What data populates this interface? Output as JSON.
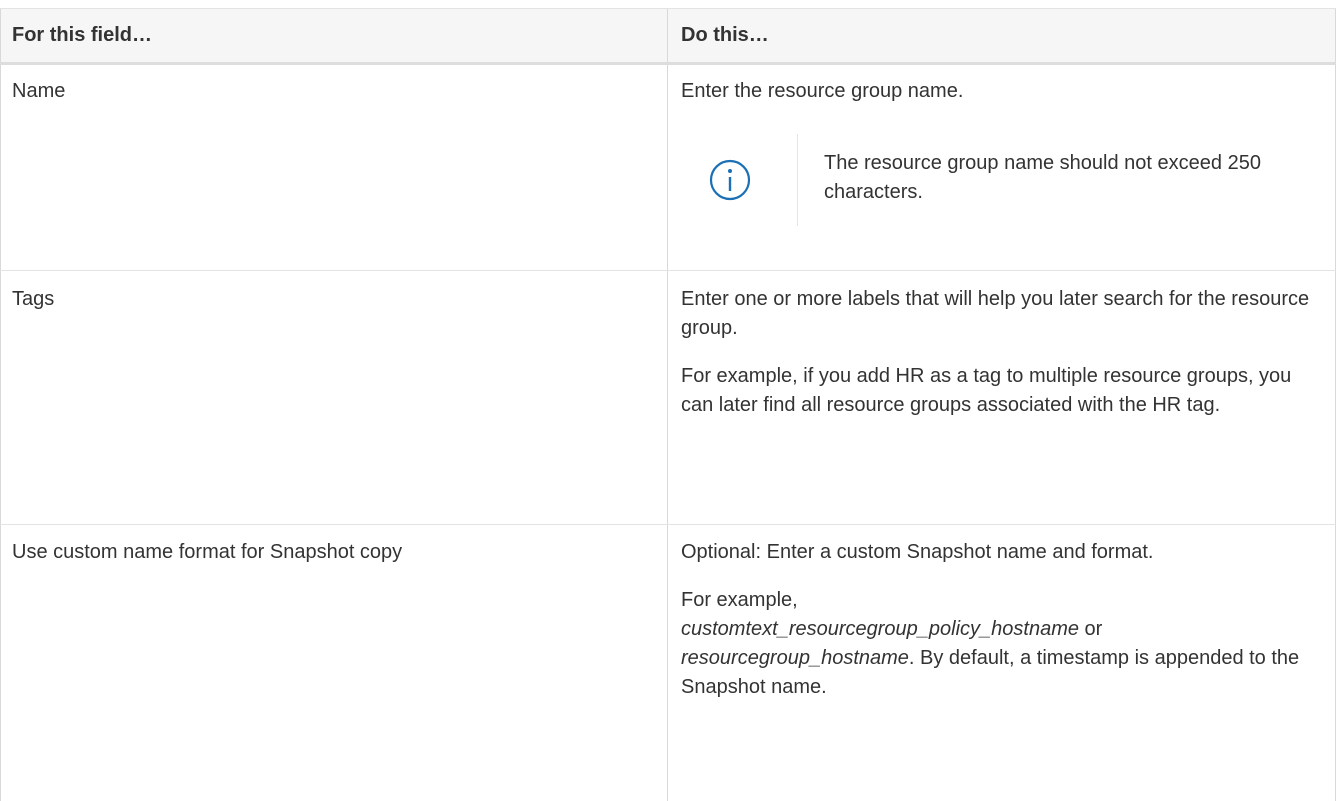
{
  "table": {
    "headers": [
      "For this field…",
      "Do this…"
    ],
    "rows": [
      {
        "field": "Name",
        "paragraphs": [
          "Enter the resource group name."
        ],
        "note": "The resource group name should not exceed 250 characters."
      },
      {
        "field": "Tags",
        "paragraphs": [
          "Enter one or more labels that will help you later search for the resource group.",
          "For example, if you add HR as a tag to multiple resource groups, you can later find all resource groups associated with the HR tag."
        ]
      },
      {
        "field": "Use custom name format for Snapshot copy",
        "paragraphs": [
          "Optional: Enter a custom Snapshot name and format."
        ],
        "example": {
          "lead": "For example,",
          "code1": "customtext_resourcegroup_policy_hostname",
          "joiner": " or",
          "code2": "resourcegroup_hostname",
          "tail": ". By default, a timestamp is appended to the Snapshot name."
        }
      }
    ]
  },
  "colors": {
    "border": "#d9d9d9",
    "header_bg": "#f6f6f6",
    "text": "#333333",
    "icon": "#1a6fb5"
  },
  "icons": {
    "note": "info-icon"
  }
}
